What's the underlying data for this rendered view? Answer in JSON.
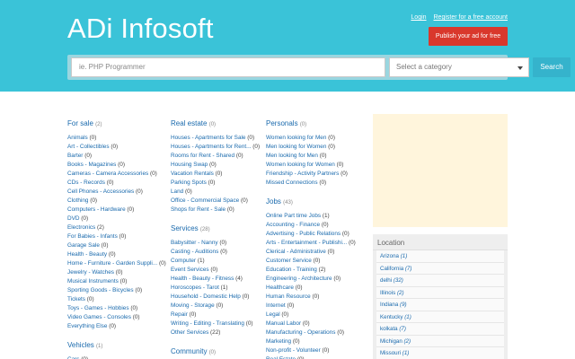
{
  "header": {
    "logo": "ADi Infosoft",
    "login": "Login",
    "register": "Register for a free account",
    "publish": "Publish your ad for free",
    "search_placeholder": "ie. PHP Programmer",
    "category_select": "Select a category",
    "search_button": "Search"
  },
  "col1": [
    {
      "title": "For sale",
      "count": "(2)",
      "items": [
        {
          "label": "Animals",
          "count": "(0)"
        },
        {
          "label": "Art - Collectibles",
          "count": "(0)"
        },
        {
          "label": "Barter",
          "count": "(0)"
        },
        {
          "label": "Books - Magazines",
          "count": "(0)"
        },
        {
          "label": "Cameras - Camera Accessories",
          "count": "(0)"
        },
        {
          "label": "CDs - Records",
          "count": "(0)"
        },
        {
          "label": "Cell Phones - Accessories",
          "count": "(0)"
        },
        {
          "label": "Clothing",
          "count": "(0)"
        },
        {
          "label": "Computers - Hardware",
          "count": "(0)"
        },
        {
          "label": "DVD",
          "count": "(0)"
        },
        {
          "label": "Electronics",
          "count": "(2)"
        },
        {
          "label": "For Babies - Infants",
          "count": "(0)"
        },
        {
          "label": "Garage Sale",
          "count": "(0)"
        },
        {
          "label": "Health - Beauty",
          "count": "(0)"
        },
        {
          "label": "Home - Furniture - Garden Suppli...",
          "count": "(0)"
        },
        {
          "label": "Jewelry - Watches",
          "count": "(0)"
        },
        {
          "label": "Musical Instruments",
          "count": "(0)"
        },
        {
          "label": "Sporting Goods - Bicycles",
          "count": "(0)"
        },
        {
          "label": "Tickets",
          "count": "(0)"
        },
        {
          "label": "Toys - Games - Hobbies",
          "count": "(0)"
        },
        {
          "label": "Video Games - Consoles",
          "count": "(0)"
        },
        {
          "label": "Everything Else",
          "count": "(0)"
        }
      ]
    },
    {
      "title": "Vehicles",
      "count": "(1)",
      "items": [
        {
          "label": "Cars",
          "count": "(0)"
        }
      ]
    }
  ],
  "col2": [
    {
      "title": "Real estate",
      "count": "(0)",
      "items": [
        {
          "label": "Houses - Apartments for Sale",
          "count": "(0)"
        },
        {
          "label": "Houses - Apartments for Rent...",
          "count": "(0)"
        },
        {
          "label": "Rooms for Rent - Shared",
          "count": "(0)"
        },
        {
          "label": "Housing Swap",
          "count": "(0)"
        },
        {
          "label": "Vacation Rentals",
          "count": "(0)"
        },
        {
          "label": "Parking Spots",
          "count": "(0)"
        },
        {
          "label": "Land",
          "count": "(0)"
        },
        {
          "label": "Office - Commercial Space",
          "count": "(0)"
        },
        {
          "label": "Shops for Rent - Sale",
          "count": "(0)"
        }
      ]
    },
    {
      "title": "Services",
      "count": "(28)",
      "items": [
        {
          "label": "Babysitter - Nanny",
          "count": "(0)"
        },
        {
          "label": "Casting - Auditions",
          "count": "(0)"
        },
        {
          "label": "Computer",
          "count": "(1)"
        },
        {
          "label": "Event Services",
          "count": "(0)"
        },
        {
          "label": "Health - Beauty - Fitness",
          "count": "(4)"
        },
        {
          "label": "Horoscopes - Tarot",
          "count": "(1)"
        },
        {
          "label": "Household - Domestic Help",
          "count": "(0)"
        },
        {
          "label": "Moving - Storage",
          "count": "(0)"
        },
        {
          "label": "Repair",
          "count": "(0)"
        },
        {
          "label": "Writing - Editing - Translating",
          "count": "(0)"
        },
        {
          "label": "Other Services",
          "count": "(22)"
        }
      ]
    },
    {
      "title": "Community",
      "count": "(0)",
      "items": []
    }
  ],
  "col3": [
    {
      "title": "Personals",
      "count": "(0)",
      "items": [
        {
          "label": "Women looking for Men",
          "count": "(0)"
        },
        {
          "label": "Men looking for Women",
          "count": "(0)"
        },
        {
          "label": "Men looking for Men",
          "count": "(0)"
        },
        {
          "label": "Women looking for Women",
          "count": "(0)"
        },
        {
          "label": "Friendship - Activity Partners",
          "count": "(0)"
        },
        {
          "label": "Missed Connections",
          "count": "(0)"
        }
      ]
    },
    {
      "title": "Jobs",
      "count": "(43)",
      "items": [
        {
          "label": "Online Part time Jobs",
          "count": "(1)"
        },
        {
          "label": "Accounting - Finance",
          "count": "(0)"
        },
        {
          "label": "Advertising - Public Relations",
          "count": "(0)"
        },
        {
          "label": "Arts - Entertainment - Publishi...",
          "count": "(0)"
        },
        {
          "label": "Clerical - Administrative",
          "count": "(0)"
        },
        {
          "label": "Customer Service",
          "count": "(0)"
        },
        {
          "label": "Education - Training",
          "count": "(2)"
        },
        {
          "label": "Engineering - Architecture",
          "count": "(0)"
        },
        {
          "label": "Healthcare",
          "count": "(0)"
        },
        {
          "label": "Human Resource",
          "count": "(0)"
        },
        {
          "label": "Internet",
          "count": "(0)"
        },
        {
          "label": "Legal",
          "count": "(0)"
        },
        {
          "label": "Manual Labor",
          "count": "(0)"
        },
        {
          "label": "Manufacturing - Operations",
          "count": "(0)"
        },
        {
          "label": "Marketing",
          "count": "(0)"
        },
        {
          "label": "Non-profit - Volunteer",
          "count": "(0)"
        },
        {
          "label": "Real Estate",
          "count": "(0)"
        }
      ]
    }
  ],
  "location": {
    "title": "Location",
    "items": [
      {
        "label": "Arizona",
        "count": "(1)"
      },
      {
        "label": "California",
        "count": "(7)"
      },
      {
        "label": "delhi",
        "count": "(32)"
      },
      {
        "label": "Illinois",
        "count": "(2)"
      },
      {
        "label": "Indiana",
        "count": "(9)"
      },
      {
        "label": "Kentucky",
        "count": "(1)"
      },
      {
        "label": "kolkata",
        "count": "(7)"
      },
      {
        "label": "Michigan",
        "count": "(2)"
      },
      {
        "label": "Missouri",
        "count": "(1)"
      }
    ]
  },
  "colors": {
    "header": "#3ac3d8",
    "link": "#1a6aad",
    "publish": "#d9382c",
    "ad_box": "#fff5dc"
  }
}
